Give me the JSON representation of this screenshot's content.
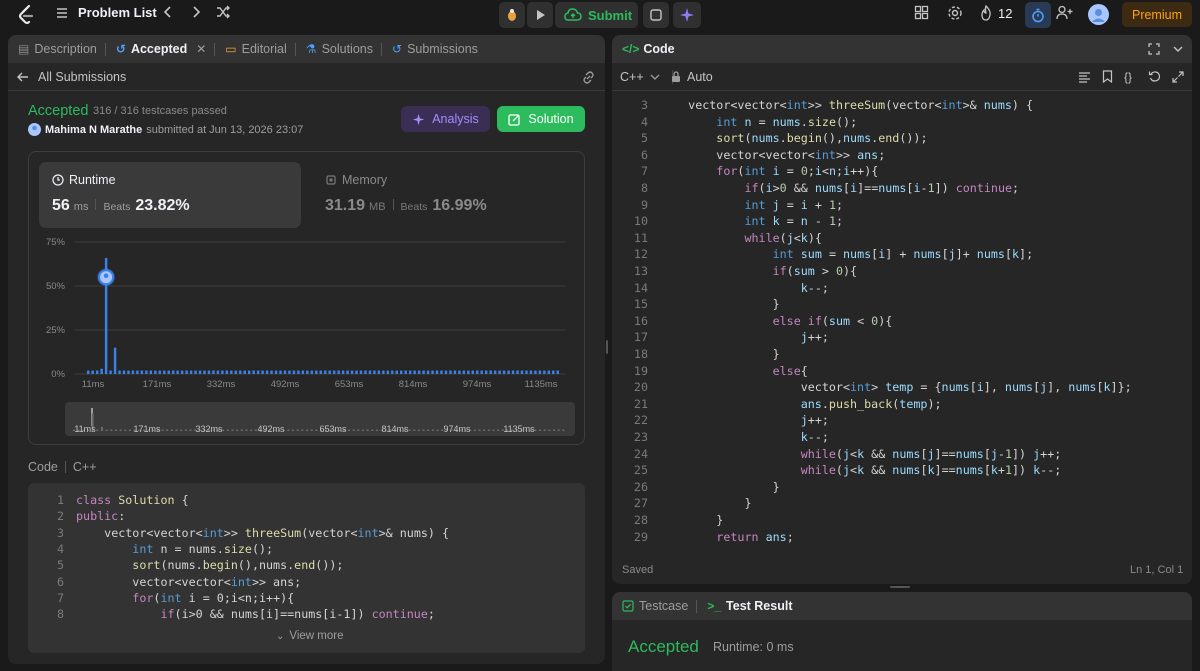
{
  "topbar": {
    "problem_list": "Problem List",
    "submit": "Submit",
    "streak": "12",
    "premium": "Premium"
  },
  "left": {
    "tabs": [
      "Description",
      "Accepted",
      "Editorial",
      "Solutions",
      "Submissions"
    ],
    "all_submissions": "All Submissions",
    "status": "Accepted",
    "testcases": "316 / 316 testcases passed",
    "user": "Mahima N Marathe",
    "submitted": "submitted at Jun 13, 2026 23:07",
    "analysis_btn": "Analysis",
    "solution_btn": "Solution",
    "runtime": {
      "label": "Runtime",
      "value": "56",
      "unit": "ms",
      "beats_label": "Beats",
      "beats": "23.82%"
    },
    "memory": {
      "label": "Memory",
      "value": "31.19",
      "unit": "MB",
      "beats_label": "Beats",
      "beats": "16.99%"
    },
    "code_label": "Code",
    "lang_label": "C++",
    "view_more": "View more"
  },
  "chart_data": {
    "type": "bar",
    "title": "",
    "yticks": [
      "75%",
      "50%",
      "25%",
      "0%"
    ],
    "ylim": [
      0,
      75
    ],
    "xticks": [
      "11ms",
      "171ms",
      "332ms",
      "492ms",
      "653ms",
      "814ms",
      "974ms",
      "1135ms"
    ],
    "highlight": {
      "x": "56ms",
      "y": 55
    },
    "values": [
      2,
      2,
      2,
      3,
      66,
      2,
      15,
      2,
      2,
      2,
      2,
      2,
      2,
      2,
      2,
      2,
      2,
      2,
      2,
      2,
      2,
      2,
      2,
      2,
      2,
      2,
      2,
      2,
      2,
      2,
      2,
      2,
      2,
      2,
      2,
      2,
      2,
      2,
      2,
      2,
      2,
      2,
      2,
      2,
      2,
      2,
      2,
      2,
      2,
      2,
      2,
      2,
      2,
      2,
      2,
      2,
      2,
      2,
      2,
      2,
      2,
      2,
      2,
      2,
      2,
      2,
      2,
      2,
      2,
      2,
      2,
      2,
      2,
      2,
      2,
      2,
      2,
      2,
      2,
      2,
      2,
      2,
      2,
      2,
      2,
      2,
      2,
      2,
      2,
      2,
      2,
      2,
      2,
      2,
      2,
      2,
      2,
      2,
      2,
      2,
      2,
      2,
      2,
      2,
      2,
      2
    ],
    "bar_color": "#3b82e8"
  },
  "preview_code": [
    {
      "n": "1",
      "html": "<span class='kw'>class</span> <span class='fn'>Solution</span> <span class='pl'>{</span>"
    },
    {
      "n": "2",
      "html": "<span class='kw'>public</span><span class='pl'>:</span>"
    },
    {
      "n": "3",
      "html": "    <span class='pl'>vector&lt;vector&lt;</span><span class='ty'>int</span><span class='pl'>&gt;&gt; </span><span class='fn'>threeSum</span><span class='pl'>(vector&lt;</span><span class='ty'>int</span><span class='pl'>&gt;&amp; nums) {</span>"
    },
    {
      "n": "4",
      "html": "        <span class='ty'>int</span> <span class='pl'>n = nums.</span><span class='fn'>size</span><span class='pl'>();</span>"
    },
    {
      "n": "5",
      "html": "        <span class='fn'>sort</span><span class='pl'>(nums.</span><span class='fn'>begin</span><span class='pl'>(),nums.</span><span class='fn'>end</span><span class='pl'>());</span>"
    },
    {
      "n": "6",
      "html": "        <span class='pl'>vector&lt;vector&lt;</span><span class='ty'>int</span><span class='pl'>&gt;&gt; ans;</span>"
    },
    {
      "n": "7",
      "html": "        <span class='kw'>for</span><span class='pl'>(</span><span class='ty'>int</span> <span class='pl'>i = 0;i&lt;n;i++){</span>"
    },
    {
      "n": "8",
      "html": "            <span class='kw'>if</span><span class='pl'>(i&gt;0 &amp;&amp; nums[i]==nums[i-1]) </span><span class='kw'>continue</span><span class='pl'>;</span>"
    }
  ],
  "right": {
    "code_title": "Code",
    "lang": "C++",
    "auto": "Auto",
    "saved": "Saved",
    "cursor": "Ln 1, Col 1",
    "testcase_tab": "Testcase",
    "result_tab": "Test Result",
    "result_status": "Accepted",
    "result_runtime": "Runtime: 0 ms"
  },
  "editor_code": [
    {
      "n": "3",
      "html": "    <span class='pl'>vector&lt;vector&lt;</span><span class='ty'>int</span><span class='pl'>&gt;&gt; </span><span class='fn'>threeSum</span><span class='pl'>(vector&lt;</span><span class='ty'>int</span><span class='pl'>&gt;&amp; </span><span class='var'>nums</span><span class='pl'>) {</span>"
    },
    {
      "n": "4",
      "html": "        <span class='ty'>int</span> <span class='var'>n</span> <span class='pl'>= </span><span class='var'>nums</span><span class='pl'>.</span><span class='fn'>size</span><span class='pl'>();</span>"
    },
    {
      "n": "5",
      "html": "        <span class='fn'>sort</span><span class='pl'>(</span><span class='var'>nums</span><span class='pl'>.</span><span class='fn'>begin</span><span class='pl'>(),</span><span class='var'>nums</span><span class='pl'>.</span><span class='fn'>end</span><span class='pl'>());</span>"
    },
    {
      "n": "6",
      "html": "        <span class='pl'>vector&lt;vector&lt;</span><span class='ty'>int</span><span class='pl'>&gt;&gt; </span><span class='var'>ans</span><span class='pl'>;</span>"
    },
    {
      "n": "7",
      "html": "        <span class='kw'>for</span><span class='pl'>(</span><span class='ty'>int</span> <span class='var'>i</span> <span class='pl'>= </span><span class='num'>0</span><span class='pl'>;</span><span class='var'>i</span><span class='pl'>&lt;</span><span class='var'>n</span><span class='pl'>;</span><span class='var'>i</span><span class='pl'>++){</span>"
    },
    {
      "n": "8",
      "html": "            <span class='kw'>if</span><span class='pl'>(</span><span class='var'>i</span><span class='pl'>&gt;</span><span class='num'>0</span> <span class='pl'>&amp;&amp; </span><span class='var'>nums</span><span class='pl'>[</span><span class='var'>i</span><span class='pl'>]==</span><span class='var'>nums</span><span class='pl'>[</span><span class='var'>i</span><span class='pl'>-</span><span class='num'>1</span><span class='pl'>]) </span><span class='kw'>continue</span><span class='pl'>;</span>"
    },
    {
      "n": "9",
      "html": "            <span class='ty'>int</span> <span class='var'>j</span> <span class='pl'>= </span><span class='var'>i</span> <span class='pl'>+ </span><span class='num'>1</span><span class='pl'>;</span>"
    },
    {
      "n": "10",
      "html": "            <span class='ty'>int</span> <span class='var'>k</span> <span class='pl'>= </span><span class='var'>n</span> <span class='pl'>- </span><span class='num'>1</span><span class='pl'>;</span>"
    },
    {
      "n": "11",
      "html": "            <span class='kw'>while</span><span class='pl'>(</span><span class='var'>j</span><span class='pl'>&lt;</span><span class='var'>k</span><span class='pl'>){</span>"
    },
    {
      "n": "12",
      "html": "                <span class='ty'>int</span> <span class='var'>sum</span> <span class='pl'>= </span><span class='var'>nums</span><span class='pl'>[</span><span class='var'>i</span><span class='pl'>] + </span><span class='var'>nums</span><span class='pl'>[</span><span class='var'>j</span><span class='pl'>]+ </span><span class='var'>nums</span><span class='pl'>[</span><span class='var'>k</span><span class='pl'>];</span>"
    },
    {
      "n": "13",
      "html": "                <span class='kw'>if</span><span class='pl'>(</span><span class='var'>sum</span> <span class='pl'>&gt; </span><span class='num'>0</span><span class='pl'>){</span>"
    },
    {
      "n": "14",
      "html": "                    <span class='var'>k</span><span class='pl'>--;</span>"
    },
    {
      "n": "15",
      "html": "                <span class='pl'>}</span>"
    },
    {
      "n": "16",
      "html": "                <span class='kw'>else if</span><span class='pl'>(</span><span class='var'>sum</span> <span class='pl'>&lt; </span><span class='num'>0</span><span class='pl'>){</span>"
    },
    {
      "n": "17",
      "html": "                    <span class='var'>j</span><span class='pl'>++;</span>"
    },
    {
      "n": "18",
      "html": "                <span class='pl'>}</span>"
    },
    {
      "n": "19",
      "html": "                <span class='kw'>else</span><span class='pl'>{</span>"
    },
    {
      "n": "20",
      "html": "                    <span class='pl'>vector&lt;</span><span class='ty'>int</span><span class='pl'>&gt; </span><span class='var'>temp</span> <span class='pl'>= {</span><span class='var'>nums</span><span class='pl'>[</span><span class='var'>i</span><span class='pl'>], </span><span class='var'>nums</span><span class='pl'>[</span><span class='var'>j</span><span class='pl'>], </span><span class='var'>nums</span><span class='pl'>[</span><span class='var'>k</span><span class='pl'>]};</span>"
    },
    {
      "n": "21",
      "html": "                    <span class='var'>ans</span><span class='pl'>.</span><span class='fn'>push_back</span><span class='pl'>(</span><span class='var'>temp</span><span class='pl'>);</span>"
    },
    {
      "n": "22",
      "html": "                    <span class='var'>j</span><span class='pl'>++;</span>"
    },
    {
      "n": "23",
      "html": "                    <span class='var'>k</span><span class='pl'>--;</span>"
    },
    {
      "n": "24",
      "html": "                    <span class='kw'>while</span><span class='pl'>(</span><span class='var'>j</span><span class='pl'>&lt;</span><span class='var'>k</span> <span class='pl'>&amp;&amp; </span><span class='var'>nums</span><span class='pl'>[</span><span class='var'>j</span><span class='pl'>]==</span><span class='var'>nums</span><span class='pl'>[</span><span class='var'>j</span><span class='pl'>-</span><span class='num'>1</span><span class='pl'>]) </span><span class='var'>j</span><span class='pl'>++;</span>"
    },
    {
      "n": "25",
      "html": "                    <span class='kw'>while</span><span class='pl'>(</span><span class='var'>j</span><span class='pl'>&lt;</span><span class='var'>k</span> <span class='pl'>&amp;&amp; </span><span class='var'>nums</span><span class='pl'>[</span><span class='var'>k</span><span class='pl'>]==</span><span class='var'>nums</span><span class='pl'>[</span><span class='var'>k</span><span class='pl'>+</span><span class='num'>1</span><span class='pl'>]) </span><span class='var'>k</span><span class='pl'>--;</span>"
    },
    {
      "n": "26",
      "html": "                <span class='pl'>}</span>"
    },
    {
      "n": "27",
      "html": "            <span class='pl'>}</span>"
    },
    {
      "n": "28",
      "html": "        <span class='pl'>}</span>"
    },
    {
      "n": "29",
      "html": "        <span class='kw'>return</span> <span class='var'>ans</span><span class='pl'>;</span>"
    }
  ]
}
